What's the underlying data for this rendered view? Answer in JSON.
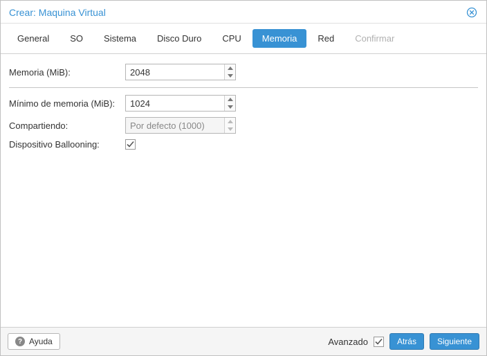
{
  "title": "Crear: Maquina Virtual",
  "tabs": {
    "general": "General",
    "os": "SO",
    "system": "Sistema",
    "disk": "Disco Duro",
    "cpu": "CPU",
    "memory": "Memoria",
    "network": "Red",
    "confirm": "Confirmar"
  },
  "form": {
    "memory_label": "Memoria (MiB):",
    "memory_value": "2048",
    "minmemory_label": "Mínimo de memoria (MiB):",
    "minmemory_value": "1024",
    "shares_label": "Compartiendo:",
    "shares_value": "Por defecto (1000)",
    "balloon_label": "Dispositivo Ballooning:"
  },
  "footer": {
    "help": "Ayuda",
    "advanced": "Avanzado",
    "back": "Atrás",
    "next": "Siguiente"
  }
}
